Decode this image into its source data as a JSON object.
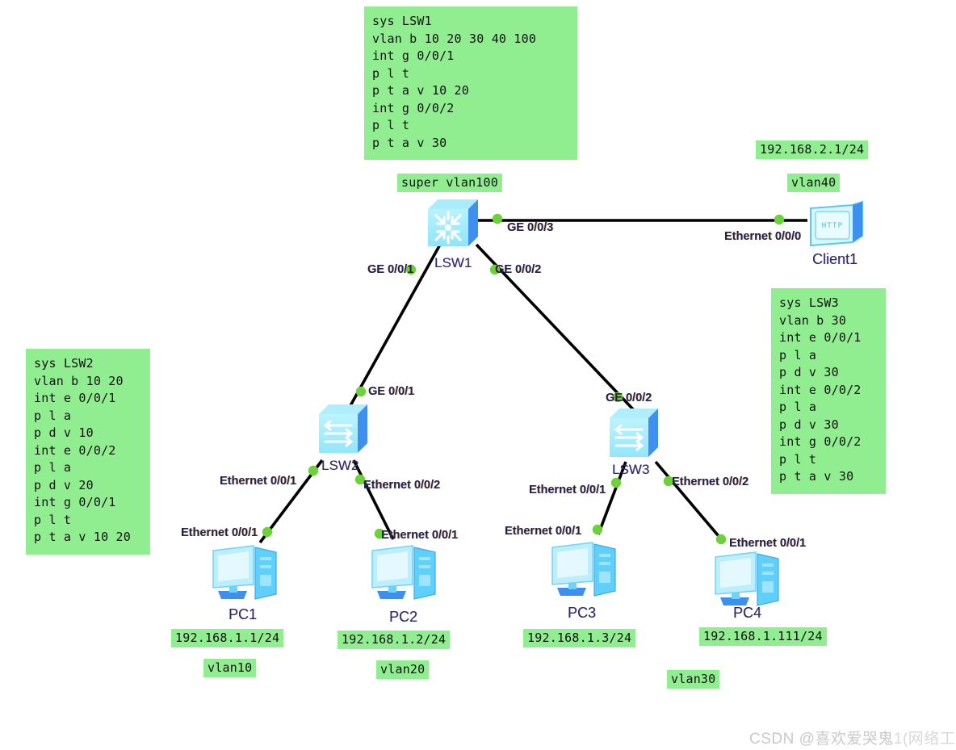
{
  "diagram": {
    "title": "eNSP VLAN topology",
    "colors": {
      "highlight": "#90ee90",
      "link": "#000000",
      "node_dot": "#6dd13a",
      "device_label": "#2a2a6a",
      "interface_label": "#22224d",
      "background": "#ffffff"
    }
  },
  "config_blocks": [
    {
      "id": "lsw1-config",
      "device": "LSW1",
      "text": "sys LSW1\nvlan b 10 20 30 40 100\nint g 0/0/1\np l t\np t a v 10 20\nint g 0/0/2\np l t\np t a v 30",
      "lines": [
        "sys LSW1",
        "vlan b 10 20 30 40 100",
        "int g 0/0/1",
        "p l t",
        "p t a v 10 20",
        "int g 0/0/2",
        "p l t",
        "p t a v 30"
      ]
    },
    {
      "id": "lsw2-config",
      "device": "LSW2",
      "text": "sys LSW2\nvlan b 10 20\nint e 0/0/1\np l a\np d v 10\nint e 0/0/2\np l a\np d v 20\nint g 0/0/1\np l t\np t a v 10 20",
      "lines": [
        "sys LSW2",
        "vlan b 10 20",
        "int e 0/0/1",
        "p l a",
        "p d v 10",
        "int e 0/0/2",
        "p l a",
        "p d v 20",
        "int g 0/0/1",
        "p l t",
        "p t a v 10 20"
      ]
    },
    {
      "id": "lsw3-config",
      "device": "LSW3",
      "text": "sys LSW3\nvlan b 30\nint e 0/0/1\np l a\np d v 30\nint e 0/0/2\np l a\np d v 30\nint g 0/0/2\np l t\np t a v 30",
      "lines": [
        "sys LSW3",
        "vlan b 30",
        "int e 0/0/1",
        "p l a",
        "p d v 30",
        "int e 0/0/2",
        "p l a",
        "p d v 30",
        "int g 0/0/2",
        "p l t",
        "p t a v 30"
      ]
    }
  ],
  "tags": {
    "super_vlan": "super vlan100",
    "client_ip": "192.168.2.1/24",
    "client_vlan": "vlan40",
    "pc1_ip": "192.168.1.1/24",
    "pc1_vlan": "vlan10",
    "pc2_ip": "192.168.1.2/24",
    "pc2_vlan": "vlan20",
    "pc3_ip": "192.168.1.3/24",
    "pc4_ip": "192.168.1.111/24",
    "pc34_vlan": "vlan30"
  },
  "devices": {
    "lsw1": {
      "label": "LSW1",
      "type": "l3-switch"
    },
    "lsw2": {
      "label": "LSW2",
      "type": "l2-switch"
    },
    "lsw3": {
      "label": "LSW3",
      "type": "l2-switch"
    },
    "client1": {
      "label": "Client1",
      "type": "client",
      "badge": "HTTP"
    },
    "pc1": {
      "label": "PC1",
      "type": "pc"
    },
    "pc2": {
      "label": "PC2",
      "type": "pc"
    },
    "pc3": {
      "label": "PC3",
      "type": "pc"
    },
    "pc4": {
      "label": "PC4",
      "type": "pc"
    }
  },
  "interfaces": {
    "lsw1_ge3": "GE 0/0/3",
    "lsw1_ge1": "GE 0/0/1",
    "lsw1_ge2": "GE 0/0/2",
    "client1_eth0": "Ethernet 0/0/0",
    "lsw2_ge1": "GE 0/0/1",
    "lsw2_eth1": "Ethernet 0/0/1",
    "lsw2_eth2": "Ethernet 0/0/2",
    "lsw3_ge2": "GE 0/0/2",
    "lsw3_eth1": "Ethernet 0/0/1",
    "lsw3_eth2": "Ethernet 0/0/2",
    "pc1_eth1": "Ethernet 0/0/1",
    "pc2_eth1": "Ethernet 0/0/1",
    "pc3_eth1": "Ethernet 0/0/1",
    "pc4_eth1": "Ethernet 0/0/1"
  },
  "watermark": {
    "prefix": "CSDN @喜欢爱哭鬼",
    "overlay": "1(网络工"
  }
}
